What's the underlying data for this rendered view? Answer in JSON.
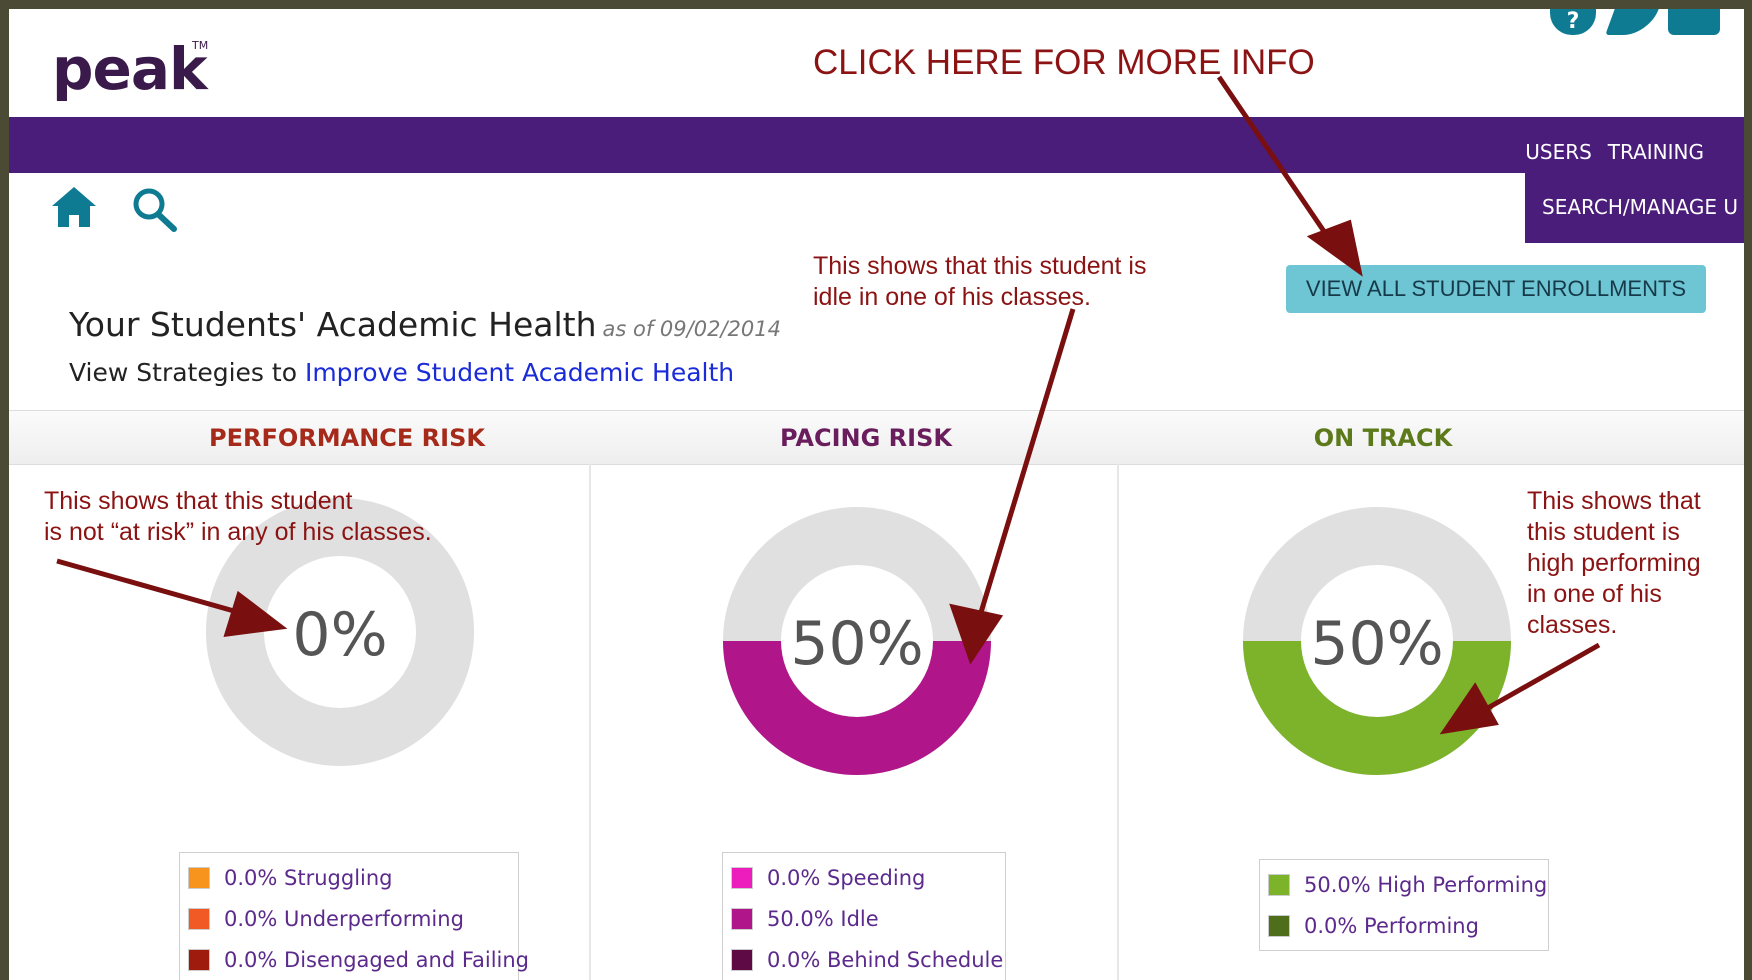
{
  "header": {
    "logo": "peak",
    "logo_tm": "TM",
    "top_icons": [
      "help-icon",
      "edit-icon",
      "chat-icon"
    ],
    "help_glyph": "?"
  },
  "nav": {
    "items": [
      "USERS",
      "TRAINING"
    ],
    "dropdown_item": "SEARCH/MANAGE U"
  },
  "toolbar": {
    "icons": [
      "home-icon",
      "search-icon"
    ]
  },
  "enrollments_button": "VIEW ALL STUDENT ENROLLMENTS",
  "title": {
    "main": "Your Students' Academic Health",
    "as_of": "as of 09/02/2014",
    "strategy_prefix": "View Strategies to",
    "strategy_link": "Improve Student Academic Health"
  },
  "annotations": {
    "more_info": "CLICK HERE FOR MORE INFO",
    "idle_line1": "This shows that this student is",
    "idle_line2": "idle in one of his classes.",
    "risk_line1": "This shows that this student",
    "risk_line2": "is not “at risk” in any of his classes.",
    "high_line1": "This shows that",
    "high_line2": "this student is",
    "high_line3": "high performing",
    "high_line4": "in one of his",
    "high_line5": "classes."
  },
  "columns": [
    {
      "title": "PERFORMANCE RISK",
      "title_color": "#a52a1a",
      "percent_label": "0%",
      "percent": 0,
      "fill_color": "#e0e0e0",
      "legend": [
        {
          "label": "0.0% Struggling",
          "color": "#f7941d"
        },
        {
          "label": "0.0% Underperforming",
          "color": "#f15a24"
        },
        {
          "label": "0.0% Disengaged and Failing",
          "color": "#9e1b0e"
        }
      ]
    },
    {
      "title": "PACING RISK",
      "title_color": "#6a1d5c",
      "percent_label": "50%",
      "percent": 50,
      "fill_color": "#b0168a",
      "legend": [
        {
          "label": "0.0% Speeding",
          "color": "#ec1cbd"
        },
        {
          "label": "50.0% Idle",
          "color": "#b0168a"
        },
        {
          "label": "0.0% Behind Schedule",
          "color": "#5e0a45"
        }
      ]
    },
    {
      "title": "ON TRACK",
      "title_color": "#5c7a1a",
      "percent_label": "50%",
      "percent": 50,
      "fill_color": "#7cb32a",
      "legend": [
        {
          "label": "50.0% High Performing",
          "color": "#7cb32a"
        },
        {
          "label": "0.0% Performing",
          "color": "#4e6e1c"
        }
      ]
    }
  ]
}
